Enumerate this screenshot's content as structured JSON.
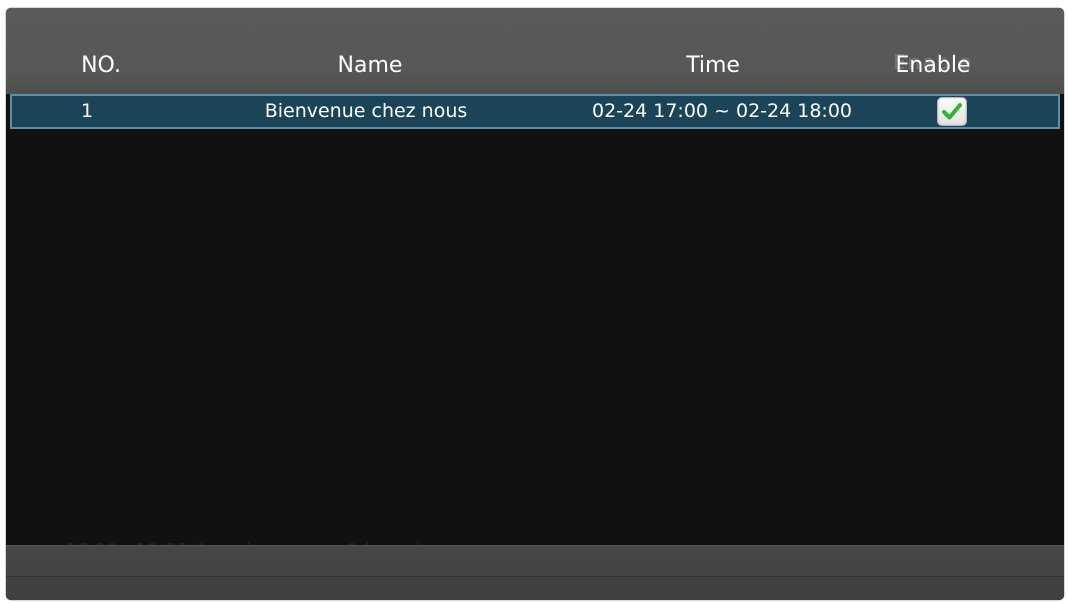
{
  "table": {
    "columns": {
      "no": "NO.",
      "name": "Name",
      "time": "Time",
      "enable": "Enable"
    },
    "rows": [
      {
        "no": "1",
        "name": "Bienvenue chez nous",
        "time": "02-24 17:00 ~ 02-24 18:00",
        "enabled": true
      }
    ]
  },
  "background_ghost": {
    "header_text": "Enable",
    "footer_text": "10:00 - 11:00 4 mariages pour 1 lune de"
  },
  "colors": {
    "header_bg": "#585858",
    "body_bg": "#111111",
    "selected_row_bg": "#1b4458",
    "selected_row_border": "#5e8fa8",
    "check_green": "#2fb52f"
  },
  "icons": {
    "enable_checkbox": "check-icon"
  }
}
